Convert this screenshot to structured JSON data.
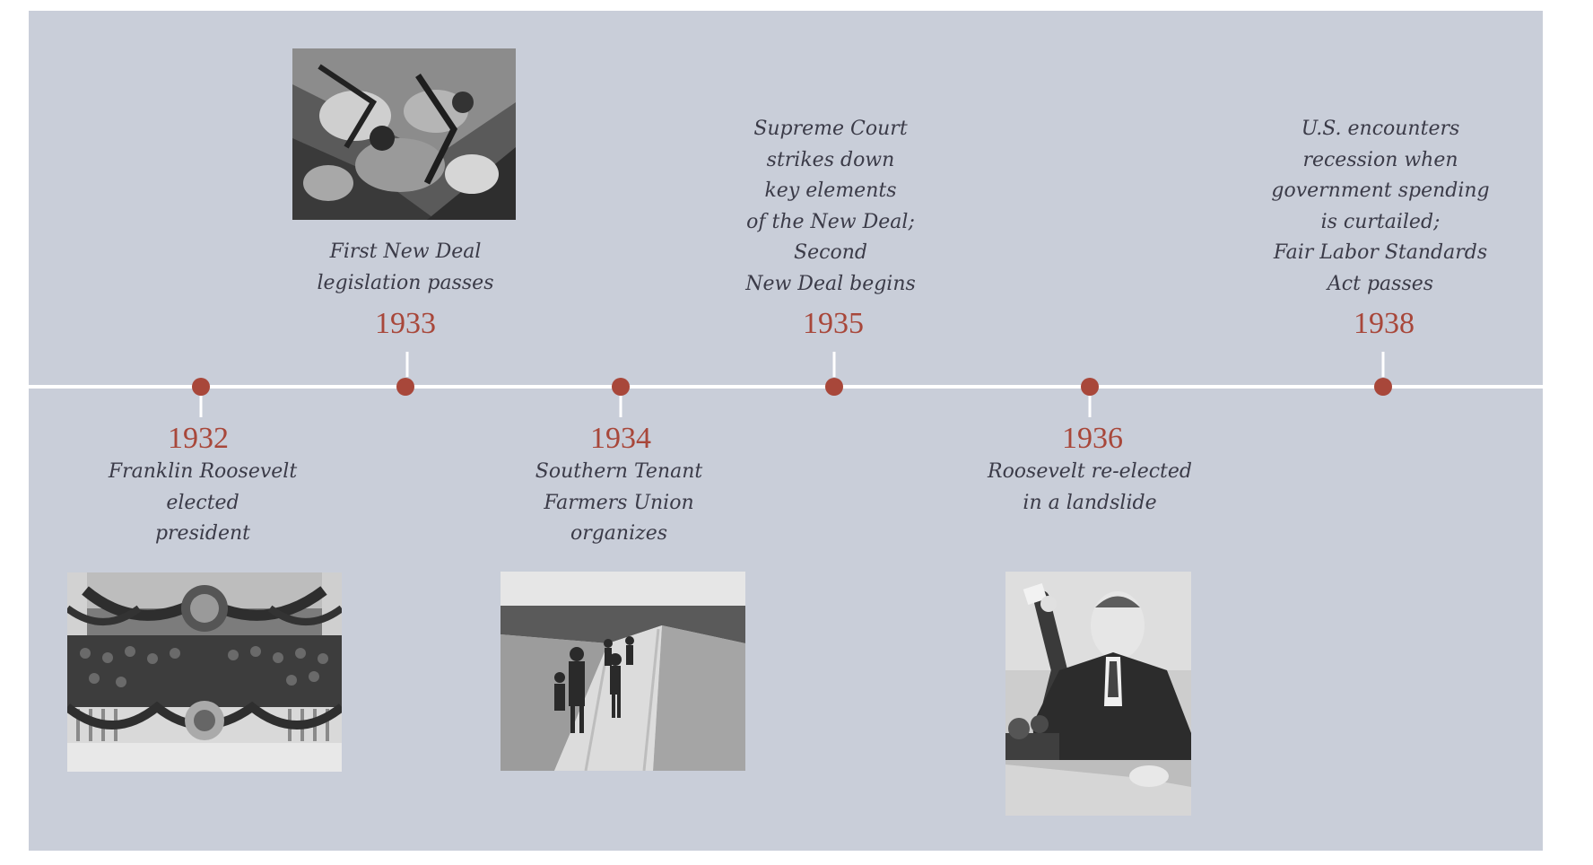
{
  "events": [
    {
      "year": "1932",
      "lines": [
        "Franklin Roosevelt",
        "elected",
        "president"
      ],
      "photo": "inauguration-photo"
    },
    {
      "year": "1933",
      "lines": [
        "First New Deal",
        "legislation passes"
      ],
      "photo": "workers-photo"
    },
    {
      "year": "1934",
      "lines": [
        "Southern Tenant",
        "Farmers Union",
        "organizes"
      ],
      "photo": "family-road-photo"
    },
    {
      "year": "1935",
      "lines": [
        "Supreme Court",
        "strikes down",
        "key elements",
        "of the New Deal;",
        "Second",
        "New Deal begins"
      ]
    },
    {
      "year": "1936",
      "lines": [
        "Roosevelt re-elected",
        "in a landslide"
      ],
      "photo": "roosevelt-speech-photo"
    },
    {
      "year": "1938",
      "lines": [
        "U.S. encounters",
        "recession when",
        "government spending",
        "is curtailed;",
        "Fair Labor Standards",
        "Act passes"
      ]
    }
  ],
  "colors": {
    "background": "#c9ced9",
    "axis": "#ffffff",
    "marker": "#a8473a",
    "year_text": "#a8473a",
    "caption_text": "#3b3b48"
  }
}
